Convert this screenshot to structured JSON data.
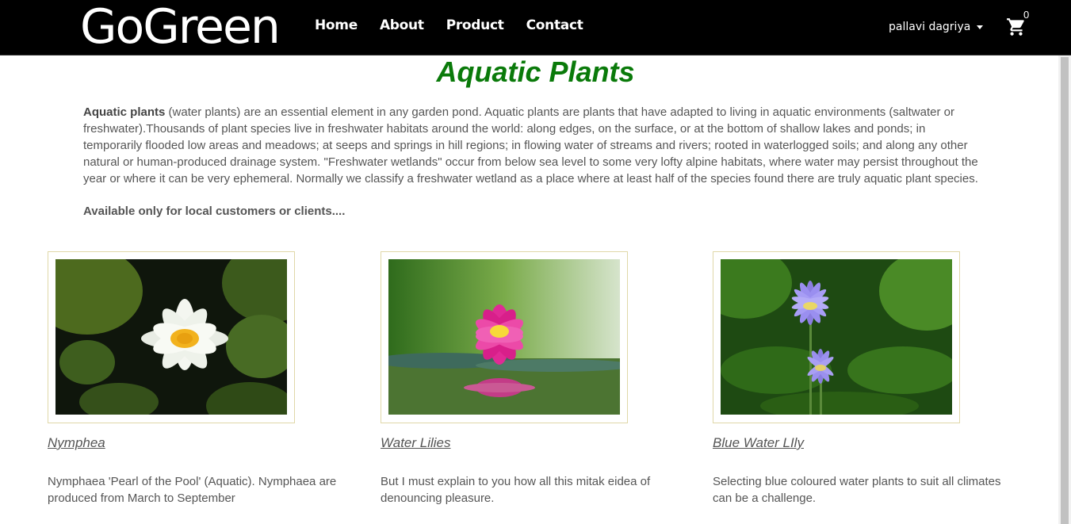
{
  "nav": {
    "brand": "GoGreen",
    "links": [
      "Home",
      "About",
      "Product",
      "Contact"
    ],
    "user": "pallavi dagriya",
    "cart_count": "0"
  },
  "page": {
    "title": "Aquatic Plants",
    "intro_bold": "Aquatic plants",
    "intro_text": " (water plants) are an essential element in any garden pond. Aquatic plants are plants that have adapted to living in aquatic environments (saltwater or freshwater).Thousands of plant species live in freshwater habitats around the world: along edges, on the surface, or at the bottom of shallow lakes and ponds; in temporarily flooded low areas and meadows; at seeps and springs in hill regions; in flowing water of streams and rivers; rooted in waterlogged soils; and along any other natural or human-produced drainage system. \"Freshwater wetlands\" occur from below sea level to some very lofty alpine habitats, where water may persist throughout the year or where it can be very ephemeral. Normally we classify a freshwater wetland as a place where at least half of the species found there are truly aquatic plant species.",
    "notice": "Available only for local customers or clients...."
  },
  "products": [
    {
      "name": "Nymphea",
      "description": "Nymphaea 'Pearl of the Pool' (Aquatic). Nymphaea are produced from March to September"
    },
    {
      "name": "Water Lilies",
      "description": "But I must explain to you how all this mitak eidea of denouncing pleasure."
    },
    {
      "name": "Blue Water LIly",
      "description": "Selecting blue coloured water plants to suit all climates can be a challenge."
    }
  ],
  "colors": {
    "navbar": "#000000",
    "title": "#0a7a0a",
    "card_border": "#e0d8a8"
  },
  "icons": {
    "cart": "shopping-cart-icon",
    "user_dropdown": "caret-down-icon"
  }
}
